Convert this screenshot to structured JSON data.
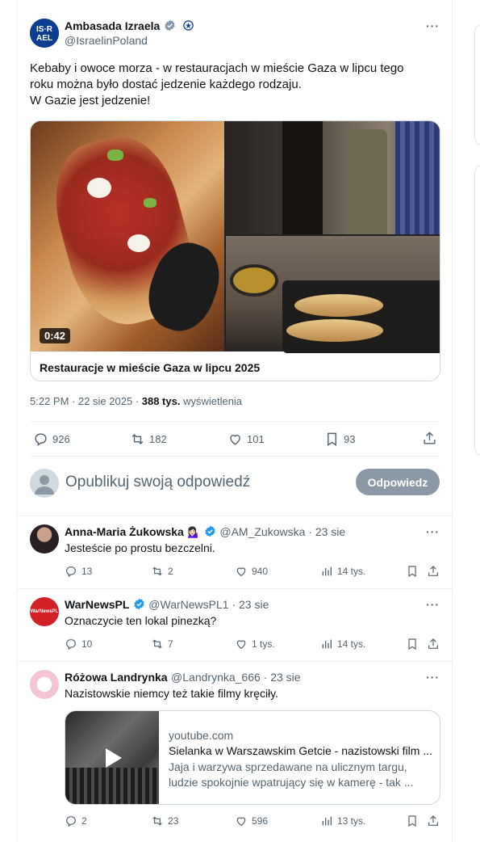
{
  "post": {
    "author_name": "Ambasada Izraela",
    "author_handle": "@IsraelinPoland",
    "avatar_text": "ISR\nAEL",
    "text_line1": "Kebaby i owoce morza - w restauracjach w mieście Gaza w lipcu tego",
    "text_line2": "roku można było dostać jedzenie każdego rodzaju.",
    "text_line3": "W Gazie jest jedzenie!",
    "video_duration": "0:42",
    "media_caption": "Restauracje w mieście Gaza w lipcu 2025",
    "time": "5:22 PM · 22 sie 2025 · ",
    "views_count": "388 tys.",
    "views_label": " wyświetlenia",
    "replies": "926",
    "reposts": "182",
    "likes": "101",
    "bookmarks": "93"
  },
  "reply_box": {
    "placeholder": "Opublikuj swoją odpowiedź",
    "button_label": "Odpowiedz"
  },
  "replies": [
    {
      "name": "Anna-Maria Żukowska",
      "emoji": "💁🏻‍♀️",
      "handle": "@AM_Zukowska · 23 sie",
      "text": "Jesteście po prostu bezczelni.",
      "replies": "13",
      "reposts": "2",
      "likes": "940",
      "views": "14 tys."
    },
    {
      "name": "WarNewsPL",
      "handle": "@WarNewsPL1 · 23 sie",
      "avatar_text": "WarNewsPL",
      "text": "Oznaczycie ten lokal pinezką?",
      "replies": "10",
      "reposts": "7",
      "likes": "1 tys.",
      "views": "14 tys."
    },
    {
      "name": "Różowa Landrynka",
      "handle": "@Landrynka_666 · 23 sie",
      "text": "Nazistowskie niemcy też takie filmy kręciły.",
      "card_domain": "youtube.com",
      "card_title": "Sielanka w Warszawskim Getcie - nazistowski film ...",
      "card_desc_line1": "Jaja i warzywa sprzedawane na ulicznym targu,",
      "card_desc_line2": "ludzie spokojnie wpatrujący się w kamerę - tak ...",
      "replies": "2",
      "reposts": "23",
      "likes": "596",
      "views": "13 tys."
    }
  ],
  "colors": {
    "accent": "#1d9bf0",
    "muted": "#536471",
    "reply_button": "#8b98a5"
  }
}
